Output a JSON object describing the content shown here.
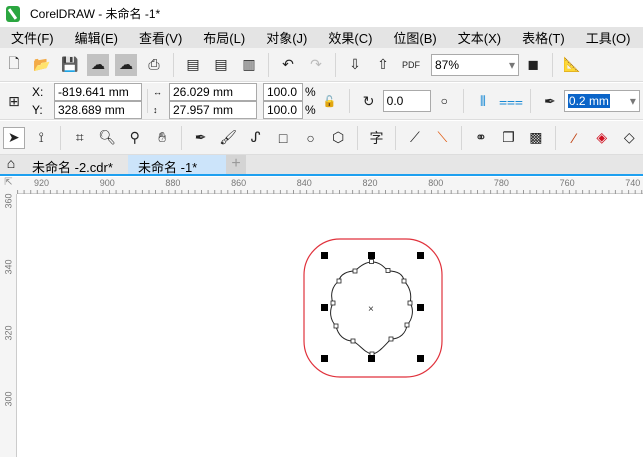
{
  "title": "CorelDRAW - 未命名 -1*",
  "menu": [
    "文件(F)",
    "编辑(E)",
    "查看(V)",
    "布局(L)",
    "对象(J)",
    "效果(C)",
    "位图(B)",
    "文本(X)",
    "表格(T)",
    "工具(O)"
  ],
  "toolbar": {
    "zoom": "87%",
    "pdf": "PDF"
  },
  "props": {
    "x_label": "X:",
    "y_label": "Y:",
    "x": "-819.641 mm",
    "y": "328.689 mm",
    "width": "26.029 mm",
    "height": "27.957 mm",
    "scale_w": "100.0",
    "scale_h": "100.0",
    "pct": "%",
    "angle": "0.0",
    "outline": "0.2 mm"
  },
  "tabs": [
    {
      "label": "未命名 -2.cdr*"
    },
    {
      "label": "未命名 -1*"
    }
  ],
  "ruler_top": [
    "920",
    "900",
    "880",
    "860",
    "840",
    "820",
    "800",
    "780",
    "760",
    "740"
  ],
  "ruler_left": [
    "360",
    "340",
    "320",
    "300"
  ],
  "colors": {
    "outline": "#e0323c",
    "accent": "#1ea0f0",
    "tab_active": "#cce4fa"
  }
}
